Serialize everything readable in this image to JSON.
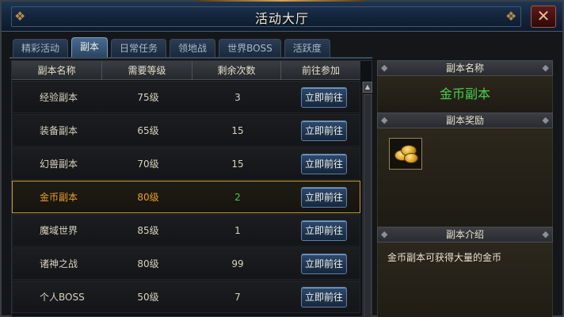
{
  "window": {
    "title": "活动大厅",
    "close_glyph": "✕"
  },
  "tabs": [
    {
      "label": "精彩活动",
      "active": false
    },
    {
      "label": "副本",
      "active": true
    },
    {
      "label": "日常任务",
      "active": false
    },
    {
      "label": "领地战",
      "active": false
    },
    {
      "label": "世界BOSS",
      "active": false
    },
    {
      "label": "活跃度",
      "active": false
    }
  ],
  "table": {
    "headers": [
      "副本名称",
      "需要等级",
      "剩余次数",
      "前往参加"
    ],
    "button_label": "立即前往",
    "selected_index": 3,
    "rows": [
      {
        "name": "经验副本",
        "level": "75级",
        "count": "3"
      },
      {
        "name": "装备副本",
        "level": "65级",
        "count": "15"
      },
      {
        "name": "幻兽副本",
        "level": "70级",
        "count": "15"
      },
      {
        "name": "金币副本",
        "level": "80级",
        "count": "2"
      },
      {
        "name": "魔域世界",
        "level": "85级",
        "count": "1"
      },
      {
        "name": "诸神之战",
        "level": "80级",
        "count": "99"
      },
      {
        "name": "个人BOSS",
        "level": "50级",
        "count": "7"
      }
    ]
  },
  "detail": {
    "name_header": "副本名称",
    "name": "金币副本",
    "reward_header": "副本奖励",
    "reward_icon": "gold-coins-icon",
    "intro_header": "副本介绍",
    "intro": "金币副本可获得大量的金币"
  },
  "colors": {
    "accent_gold": "#c79c3a",
    "selected_text": "#e9a02e",
    "green_text": "#49cf4a",
    "button_blue": "#2c4a6e"
  }
}
